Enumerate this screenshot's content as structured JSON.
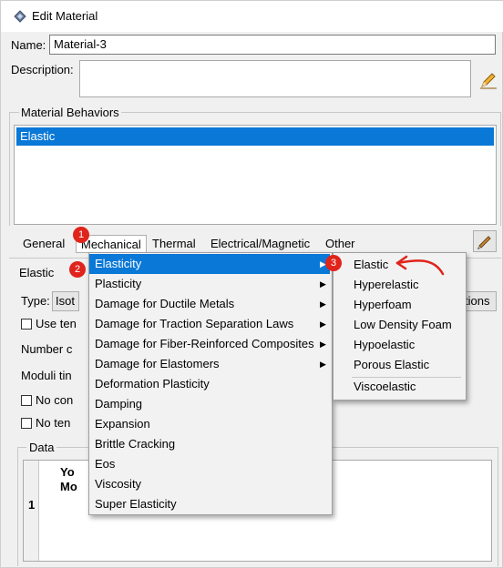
{
  "window": {
    "title": "Edit Material"
  },
  "form": {
    "name_label": "Name:",
    "name_value": "Material-3",
    "description_label": "Description:"
  },
  "material_behaviors": {
    "label": "Material Behaviors",
    "items": [
      "Elastic"
    ]
  },
  "menubar": {
    "items": [
      "General",
      "Mechanical",
      "Thermal",
      "Electrical/Magnetic",
      "Other"
    ]
  },
  "behind": {
    "section_label": "Elastic",
    "type_label": "Type:",
    "type_value": "Isot",
    "suboptions_partial": "tions",
    "use_temp": "Use ten",
    "number_of": "Number c",
    "moduli": "Moduli tin",
    "no_comp": "No con",
    "no_tension": "No ten",
    "data_label": "Data",
    "col_header_1": "Yo",
    "col_header_2": "Mo",
    "row_1": "1"
  },
  "mechanical_menu": {
    "items": [
      "Elasticity",
      "Plasticity",
      "Damage for Ductile Metals",
      "Damage for Traction Separation Laws",
      "Damage for Fiber-Reinforced Composites",
      "Damage for Elastomers",
      "Deformation Plasticity",
      "Damping",
      "Expansion",
      "Brittle Cracking",
      "Eos",
      "Viscosity",
      "Super Elasticity"
    ]
  },
  "elasticity_menu": {
    "items": [
      "Elastic",
      "Hyperelastic",
      "Hyperfoam",
      "Low Density Foam",
      "Hypoelastic",
      "Porous Elastic",
      "Viscoelastic"
    ]
  },
  "badges": [
    "1",
    "2",
    "3"
  ],
  "colors": {
    "highlight": "#0a78d7",
    "badge": "#e0241b",
    "annotation_arrow": "#e0241b"
  }
}
